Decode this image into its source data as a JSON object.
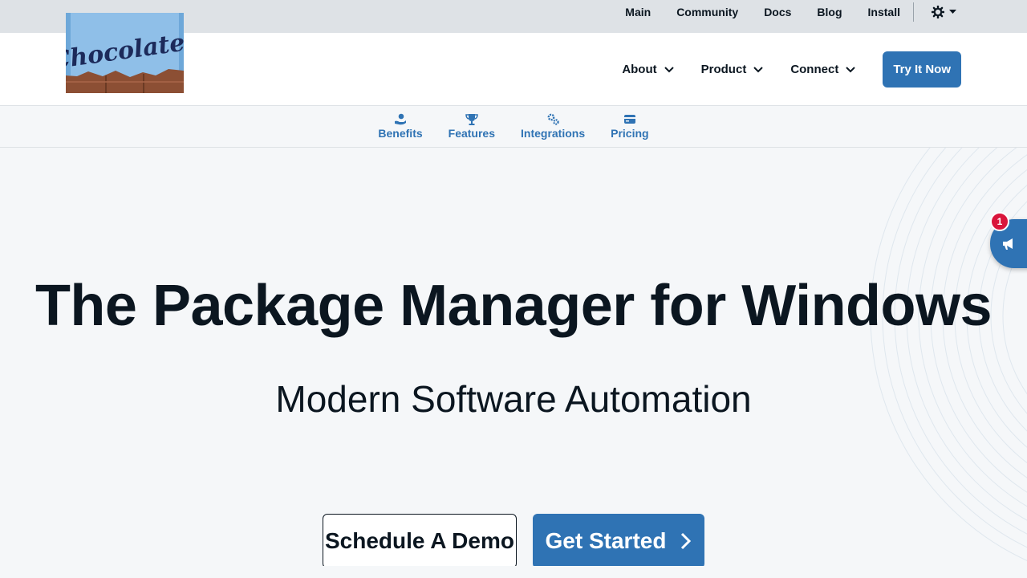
{
  "topnav": {
    "links": [
      "Main",
      "Community",
      "Docs",
      "Blog",
      "Install"
    ],
    "theme_icon": "gear-icon"
  },
  "logo": {
    "text": "Chocolatey"
  },
  "mainnav": {
    "items": [
      "About",
      "Product",
      "Connect"
    ],
    "cta": "Try It Now"
  },
  "subnav": {
    "items": [
      {
        "label": "Benefits",
        "icon": "hand-user-icon"
      },
      {
        "label": "Features",
        "icon": "trophy-icon"
      },
      {
        "label": "Integrations",
        "icon": "gears-icon"
      },
      {
        "label": "Pricing",
        "icon": "credit-card-icon"
      }
    ]
  },
  "hero": {
    "title": "The Package Manager for Windows",
    "subtitle": "Modern Software Automation",
    "demo_button": "Schedule A Demo",
    "start_button": "Get Started"
  },
  "announcement": {
    "badge_count": "1",
    "icon": "megaphone-icon"
  },
  "colors": {
    "brand_blue": "#2f73b4",
    "badge_red": "#d9153b",
    "text_dark": "#0b1620"
  }
}
